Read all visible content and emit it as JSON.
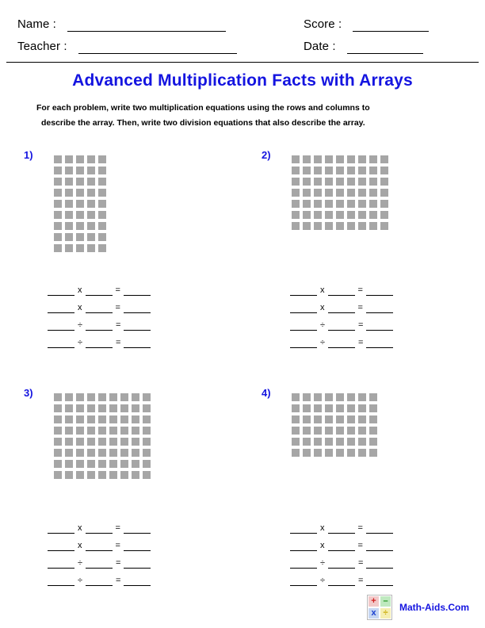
{
  "header": {
    "name_label": "Name :",
    "teacher_label": "Teacher :",
    "score_label": "Score :",
    "date_label": "Date :",
    "name_value": "",
    "teacher_value": "",
    "score_value": "",
    "date_value": ""
  },
  "title": "Advanced Multiplication Facts with Arrays",
  "instructions": {
    "line1": "For each problem, write two multiplication equations using the rows and columns to",
    "line2": "describe the array. Then, write two division equations that also describe the array."
  },
  "colors": {
    "title_blue": "#1414e0",
    "array_gray": "#a6a6a6",
    "text_black": "#000000",
    "logo_plus": "#d02020",
    "logo_minus": "#179017",
    "logo_times": "#1a3fd0",
    "logo_divide": "#c8a800"
  },
  "operators": {
    "multiply": "x",
    "divide": "÷",
    "equals": "="
  },
  "problems": [
    {
      "number": "1)",
      "rows": 9,
      "cols": 5,
      "equations": [
        {
          "op": "x"
        },
        {
          "op": "x"
        },
        {
          "op": "÷"
        },
        {
          "op": "÷"
        }
      ]
    },
    {
      "number": "2)",
      "rows": 7,
      "cols": 9,
      "equations": [
        {
          "op": "x"
        },
        {
          "op": "x"
        },
        {
          "op": "÷"
        },
        {
          "op": "÷"
        }
      ]
    },
    {
      "number": "3)",
      "rows": 8,
      "cols": 9,
      "equations": [
        {
          "op": "x"
        },
        {
          "op": "x"
        },
        {
          "op": "÷"
        },
        {
          "op": "÷"
        }
      ]
    },
    {
      "number": "4)",
      "rows": 6,
      "cols": 8,
      "equations": [
        {
          "op": "x"
        },
        {
          "op": "x"
        },
        {
          "op": "÷"
        },
        {
          "op": "÷"
        }
      ]
    }
  ],
  "footer": {
    "site": "Math-Aids.Com",
    "logo_cells": [
      "+",
      "–",
      "x",
      "÷"
    ]
  }
}
